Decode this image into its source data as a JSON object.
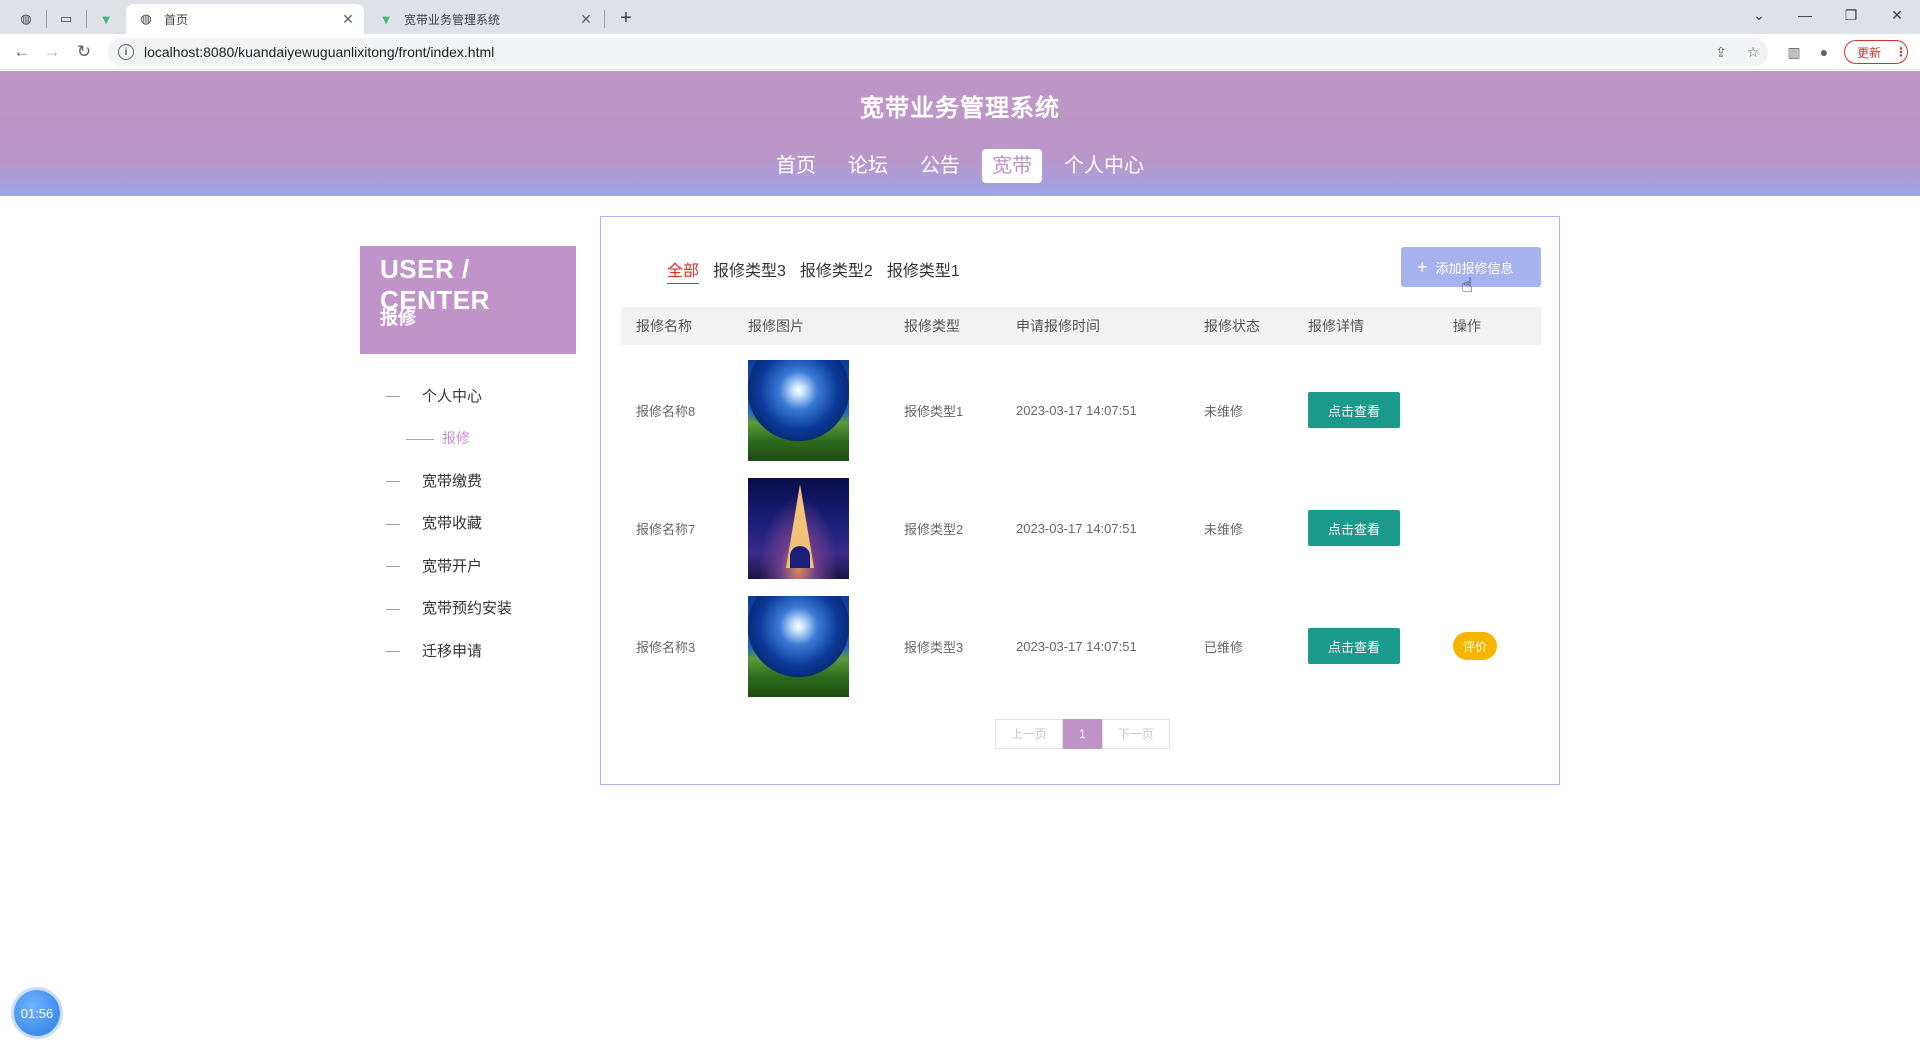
{
  "browser": {
    "tabs": [
      {
        "title": "",
        "icon": "globe-icon",
        "pinned": true
      },
      {
        "title": "",
        "icon": "blank-page-icon",
        "pinned": true
      },
      {
        "title": "",
        "icon": "vue-logo-icon",
        "pinned": true
      },
      {
        "title": "首页",
        "icon": "globe-icon",
        "active": true
      },
      {
        "title": "宽带业务管理系统",
        "icon": "vue-logo-icon",
        "active": false
      }
    ],
    "url": "localhost:8080/kuandaiyewuguanlixitong/front/index.html",
    "update_label": "更新",
    "newtab_symbol": "+"
  },
  "site": {
    "title": "宽带业务管理系统",
    "nav": [
      {
        "label": "首页",
        "active": false
      },
      {
        "label": "论坛",
        "active": false
      },
      {
        "label": "公告",
        "active": false
      },
      {
        "label": "宽带",
        "active": true
      },
      {
        "label": "个人中心",
        "active": false
      }
    ]
  },
  "sidebar": {
    "title_en": "USER / CENTER",
    "title_cn": "报修",
    "items": [
      {
        "label": "个人中心",
        "sub": false
      },
      {
        "label": "报修",
        "sub": true
      },
      {
        "label": "宽带缴费",
        "sub": false
      },
      {
        "label": "宽带收藏",
        "sub": false
      },
      {
        "label": "宽带开户",
        "sub": false
      },
      {
        "label": "宽带预约安装",
        "sub": false
      },
      {
        "label": "迁移申请",
        "sub": false
      }
    ]
  },
  "filters": [
    {
      "label": "全部",
      "active": true
    },
    {
      "label": "报修类型3",
      "active": false
    },
    {
      "label": "报修类型2",
      "active": false
    },
    {
      "label": "报修类型1",
      "active": false
    }
  ],
  "add_button": "添加报修信息",
  "table": {
    "headers": [
      "报修名称",
      "报修图片",
      "报修类型",
      "申请报修时间",
      "报修状态",
      "报修详情",
      "操作"
    ],
    "rows": [
      {
        "name": "报修名称8",
        "image": "grass-sky",
        "type": "报修类型1",
        "time": "2023-03-17 14:07:51",
        "status": "未维修",
        "detail": "点击查看",
        "action": ""
      },
      {
        "name": "报修名称7",
        "image": "eiffel-tower",
        "type": "报修类型2",
        "time": "2023-03-17 14:07:51",
        "status": "未维修",
        "detail": "点击查看",
        "action": ""
      },
      {
        "name": "报修名称3",
        "image": "grass-sky",
        "type": "报修类型3",
        "time": "2023-03-17 14:07:51",
        "status": "已维修",
        "detail": "点击查看",
        "action": "评价"
      }
    ]
  },
  "pager": {
    "prev": "上一页",
    "current": "1",
    "next": "下一页"
  },
  "timer": "01:56",
  "colors": {
    "accent": "#c194c9",
    "header_gradient_end": "#9aa6ea",
    "view_button": "#1a9a8a",
    "rate_button": "#f7b500",
    "add_button": "#a7b3ee",
    "filter_active": "#d93025"
  }
}
